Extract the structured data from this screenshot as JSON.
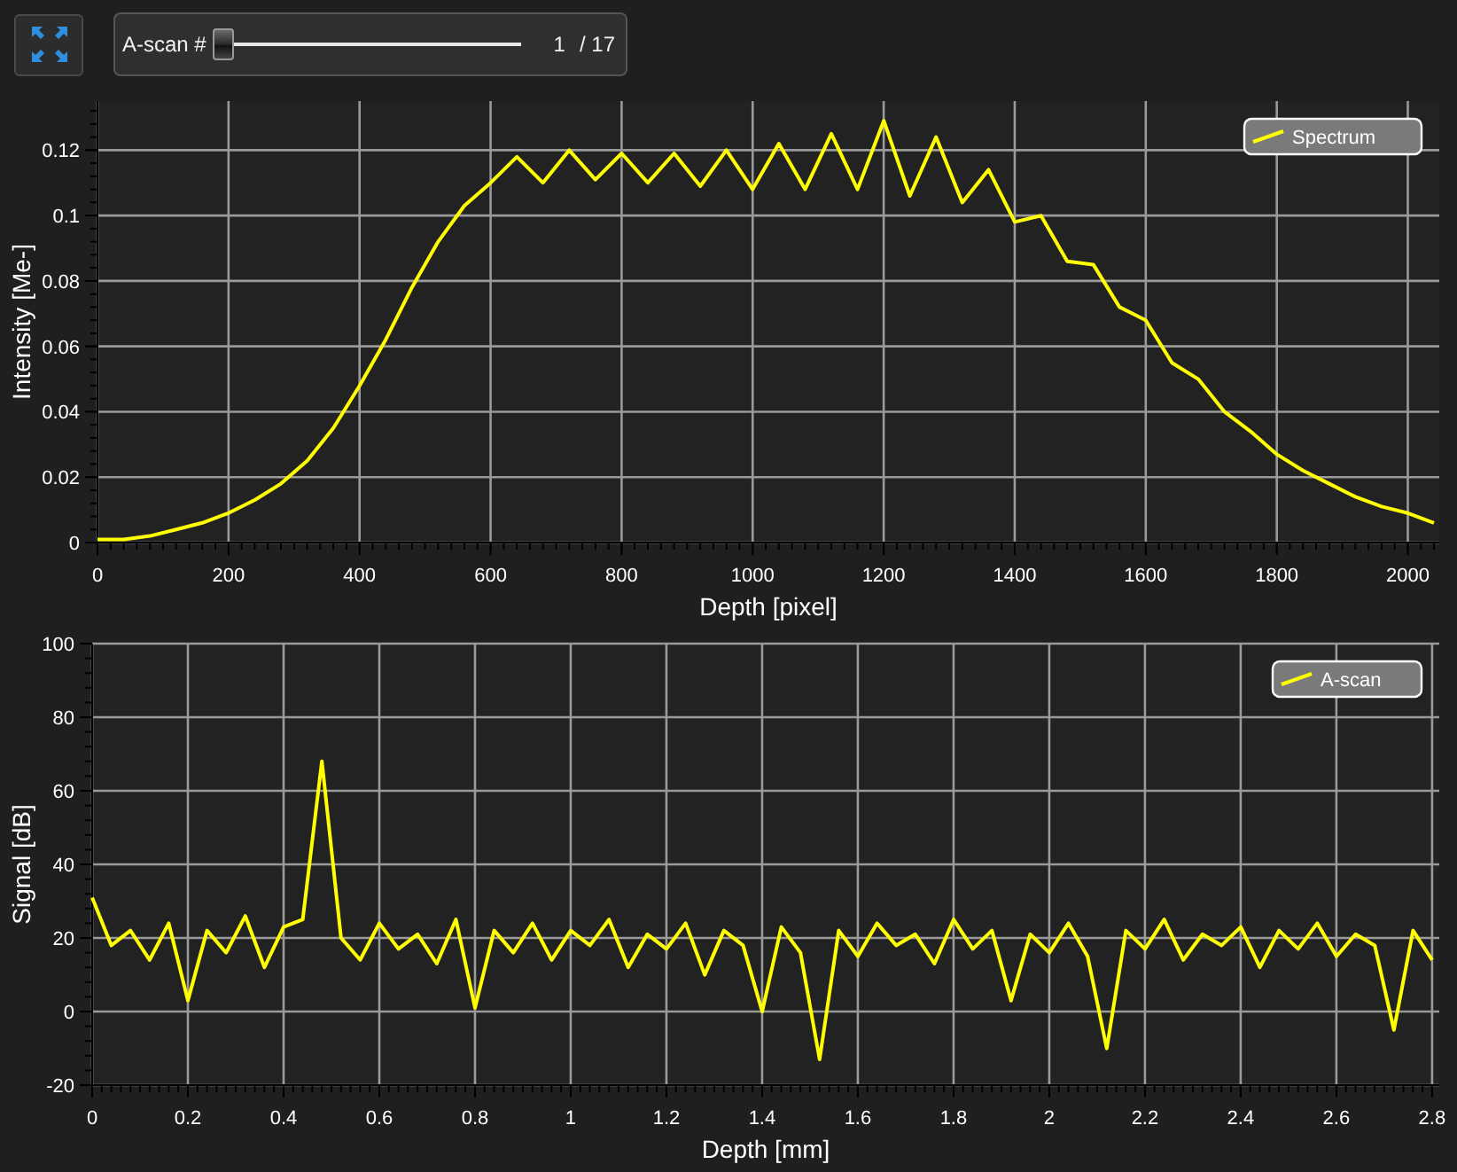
{
  "toolbar": {
    "expand_button": {
      "kind": "icon"
    },
    "slider": {
      "label": "A-scan #",
      "level": 0,
      "current": "1",
      "total": "/ 17"
    }
  },
  "spectrum_panel": {
    "chart_data": {
      "type": "line",
      "grid": true,
      "xlabel": "Depth [pixel]",
      "ylabel": "Intensity [Me-]",
      "xlim": [
        0,
        2048
      ],
      "ylim": [
        0,
        0.135
      ],
      "xticks": [
        0,
        200,
        400,
        600,
        800,
        1000,
        1200,
        1400,
        1600,
        1800,
        2000
      ],
      "yticks": [
        0,
        0.02,
        0.04,
        0.06,
        0.08,
        0.1,
        0.12
      ],
      "x": [
        0,
        40,
        80,
        120,
        160,
        200,
        240,
        280,
        320,
        360,
        400,
        440,
        480,
        520,
        560,
        600,
        640,
        680,
        720,
        760,
        800,
        840,
        880,
        920,
        960,
        1000,
        1040,
        1080,
        1120,
        1160,
        1200,
        1240,
        1280,
        1320,
        1360,
        1400,
        1440,
        1480,
        1520,
        1560,
        1600,
        1640,
        1680,
        1720,
        1760,
        1800,
        1840,
        1880,
        1920,
        1960,
        2000,
        2040
      ],
      "series": [
        {
          "name": "Spectrum",
          "color": "#ffff00",
          "values": [
            0.001,
            0.001,
            0.002,
            0.004,
            0.006,
            0.009,
            0.013,
            0.018,
            0.025,
            0.035,
            0.048,
            0.062,
            0.078,
            0.092,
            0.103,
            0.11,
            0.118,
            0.11,
            0.12,
            0.111,
            0.119,
            0.11,
            0.119,
            0.109,
            0.12,
            0.108,
            0.122,
            0.108,
            0.125,
            0.108,
            0.129,
            0.106,
            0.124,
            0.104,
            0.114,
            0.098,
            0.1,
            0.086,
            0.085,
            0.072,
            0.068,
            0.055,
            0.05,
            0.04,
            0.034,
            0.027,
            0.022,
            0.018,
            0.014,
            0.011,
            0.009,
            0.006
          ]
        }
      ]
    }
  },
  "ascan_panel": {
    "chart_data": {
      "type": "line",
      "grid": true,
      "xlabel": "Depth [mm]",
      "ylabel": "Signal [dB]",
      "xlim": [
        0,
        2.815
      ],
      "ylim": [
        -20,
        100
      ],
      "xticks": [
        0,
        0.2,
        0.4,
        0.6,
        0.8,
        1,
        1.2,
        1.4,
        1.6,
        1.8,
        2,
        2.2,
        2.4,
        2.6,
        2.8
      ],
      "yticks": [
        -20,
        0,
        20,
        40,
        60,
        80,
        100
      ],
      "x": [
        0,
        0.04,
        0.08,
        0.12,
        0.16,
        0.2,
        0.24,
        0.28,
        0.32,
        0.36,
        0.4,
        0.44,
        0.48,
        0.52,
        0.56,
        0.6,
        0.64,
        0.68,
        0.72,
        0.76,
        0.8,
        0.84,
        0.88,
        0.92,
        0.96,
        1,
        1.04,
        1.08,
        1.12,
        1.16,
        1.2,
        1.24,
        1.28,
        1.32,
        1.36,
        1.4,
        1.44,
        1.48,
        1.52,
        1.56,
        1.6,
        1.64,
        1.68,
        1.72,
        1.76,
        1.8,
        1.84,
        1.88,
        1.92,
        1.96,
        2,
        2.04,
        2.08,
        2.12,
        2.16,
        2.2,
        2.24,
        2.28,
        2.32,
        2.36,
        2.4,
        2.44,
        2.48,
        2.52,
        2.56,
        2.6,
        2.64,
        2.68,
        2.72,
        2.76,
        2.8
      ],
      "series": [
        {
          "name": "A-scan",
          "color": "#ffff00",
          "values": [
            31,
            18,
            22,
            14,
            24,
            3,
            22,
            16,
            26,
            12,
            23,
            25,
            68,
            20,
            14,
            24,
            17,
            21,
            13,
            25,
            1,
            22,
            16,
            24,
            14,
            22,
            18,
            25,
            12,
            21,
            17,
            24,
            10,
            22,
            18,
            0,
            23,
            16,
            -13,
            22,
            15,
            24,
            18,
            21,
            13,
            25,
            17,
            22,
            3,
            21,
            16,
            24,
            15,
            -10,
            22,
            17,
            25,
            14,
            21,
            18,
            23,
            12,
            22,
            17,
            24,
            15,
            21,
            18,
            -5,
            22,
            14
          ]
        }
      ]
    }
  }
}
